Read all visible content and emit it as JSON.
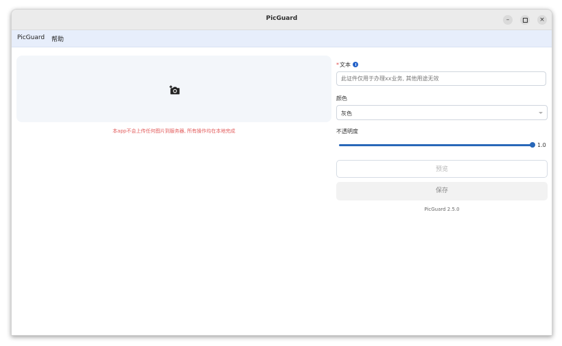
{
  "window": {
    "title": "PicGuard",
    "controls": {
      "minimize": "–",
      "close": "×"
    }
  },
  "menu": {
    "items": [
      "PicGuard",
      "帮助"
    ]
  },
  "upload": {
    "icon": "add-photo-icon",
    "notice": "本app不会上传任何图片到服务器, 所有操作均在本地完成"
  },
  "form": {
    "text": {
      "required_mark": "*",
      "label": "文本",
      "info_icon": "info-icon",
      "placeholder": "此证件仅用于办理xx业务, 其他用途无效",
      "value": ""
    },
    "color": {
      "label": "颜色",
      "selected": "灰色"
    },
    "opacity": {
      "label": "不透明度",
      "value": 1.0,
      "value_text": "1.0"
    }
  },
  "buttons": {
    "preview": "预览",
    "save": "保存"
  },
  "footer": {
    "version": "PicGuard 2.5.0"
  },
  "colors": {
    "accent": "#2867b8",
    "notice": "#e25a5a",
    "menubar": "#e7eefb",
    "dropzone": "#f3f6fa"
  }
}
